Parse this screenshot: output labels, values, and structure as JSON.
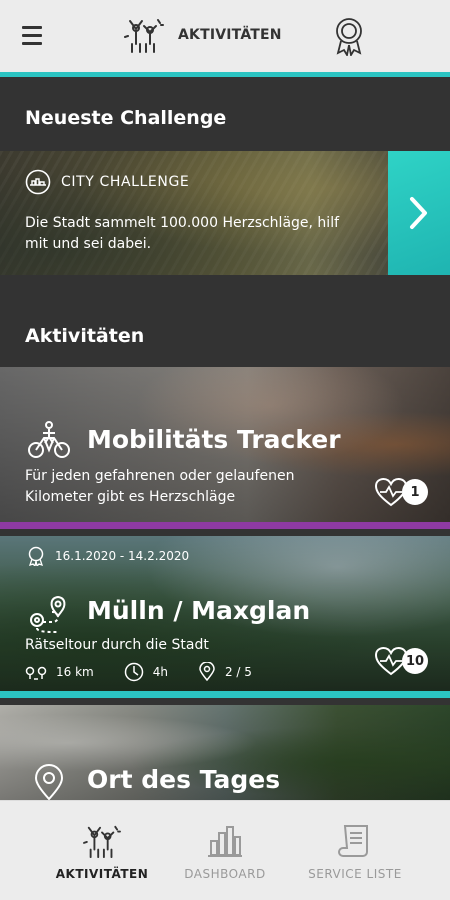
{
  "header": {
    "title": "AKTIVITÄTEN",
    "menu_icon": "hamburger-menu-icon",
    "logo_icon": "cheering-people-icon",
    "badge_icon": "award-badge-icon",
    "accent_color": "#2bc4c2"
  },
  "latest_challenge": {
    "section_title": "Neueste Challenge",
    "label": "CITY CHALLENGE",
    "description": "Die Stadt sammelt 100.000 Herzschläge, hilf mit und sei dabei.",
    "icon": "city-icon",
    "next_icon": "chevron-right-icon"
  },
  "activities": {
    "section_title": "Aktivitäten",
    "items": [
      {
        "title": "Mobilitäts Tracker",
        "description": "Für jeden gefahrenen oder gelaufenen Kilometer gibt es Herzschläge",
        "icon": "bike-runner-icon",
        "hearts": "1",
        "bar_color": "#8e3aa3"
      },
      {
        "date": "16.1.2020 - 14.2.2020",
        "title": "Mülln / Maxglan",
        "description": "Rätseltour durch die Stadt",
        "icon": "route-pin-icon",
        "hearts": "10",
        "stats": {
          "distance": "16 km",
          "duration": "4h",
          "stations": "2 / 5"
        },
        "bar_color": "#2bc4c2"
      },
      {
        "title": "Ort des Tages",
        "icon": "location-pin-icon"
      }
    ]
  },
  "bottom_nav": {
    "items": [
      {
        "label": "AKTIVITÄTEN",
        "icon": "cheering-people-icon",
        "active": true
      },
      {
        "label": "DASHBOARD",
        "icon": "bar-chart-icon",
        "active": false
      },
      {
        "label": "SERVICE LISTE",
        "icon": "scroll-list-icon",
        "active": false
      }
    ]
  }
}
